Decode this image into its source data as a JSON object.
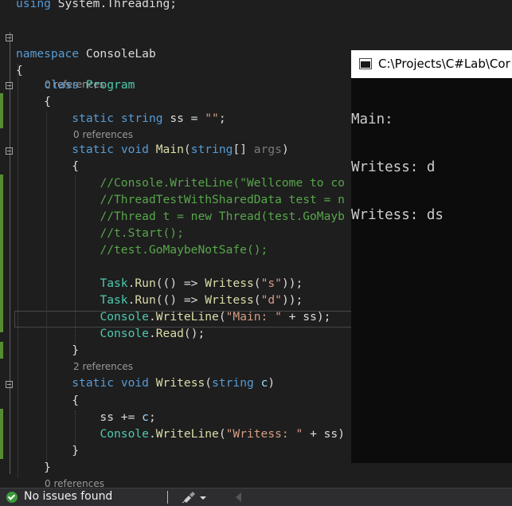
{
  "editor": {
    "lines": [
      {
        "tokens": [
          {
            "t": "using",
            "c": "kw"
          },
          {
            "t": " System.Threading;",
            "c": "ns"
          }
        ]
      },
      {
        "tokens": []
      },
      {
        "tokens": [
          {
            "t": "namespace",
            "c": "kw"
          },
          {
            "t": " ConsoleLab",
            "c": "ns"
          }
        ]
      },
      {
        "tokens": [
          {
            "t": "{",
            "c": "ns"
          }
        ]
      },
      {
        "lens": "0 references"
      },
      {
        "tokens": [
          {
            "t": "    "
          },
          {
            "t": "class",
            "c": "kw"
          },
          {
            "t": " "
          },
          {
            "t": "Program",
            "c": "ty"
          }
        ]
      },
      {
        "tokens": [
          {
            "t": "    {",
            "c": "ns"
          }
        ]
      },
      {
        "tokens": [
          {
            "t": "        "
          },
          {
            "t": "static",
            "c": "kw"
          },
          {
            "t": " "
          },
          {
            "t": "string",
            "c": "kw"
          },
          {
            "t": " ss = ",
            "c": "ns"
          },
          {
            "t": "\"\"",
            "c": "st"
          },
          {
            "t": ";",
            "c": "ns"
          }
        ]
      },
      {
        "lens": "0 references"
      },
      {
        "tokens": [
          {
            "t": "        "
          },
          {
            "t": "static",
            "c": "kw"
          },
          {
            "t": " "
          },
          {
            "t": "void",
            "c": "kw"
          },
          {
            "t": " "
          },
          {
            "t": "Main",
            "c": "fn"
          },
          {
            "t": "(",
            "c": "ns"
          },
          {
            "t": "string",
            "c": "kw"
          },
          {
            "t": "[] ",
            "c": "ns"
          },
          {
            "t": "args",
            "c": "dim"
          },
          {
            "t": ")",
            "c": "ns"
          }
        ]
      },
      {
        "tokens": [
          {
            "t": "        {",
            "c": "ns"
          }
        ]
      },
      {
        "tokens": [
          {
            "t": "            "
          },
          {
            "t": "//Console.WriteLine(\"Wellcome to co",
            "c": "cm"
          }
        ]
      },
      {
        "tokens": [
          {
            "t": "            "
          },
          {
            "t": "//ThreadTestWithSharedData test = n",
            "c": "cm"
          }
        ]
      },
      {
        "tokens": [
          {
            "t": "            "
          },
          {
            "t": "//Thread t = new Thread(test.GoMayb",
            "c": "cm"
          }
        ]
      },
      {
        "tokens": [
          {
            "t": "            "
          },
          {
            "t": "//t.Start();",
            "c": "cm"
          }
        ]
      },
      {
        "tokens": [
          {
            "t": "            "
          },
          {
            "t": "//test.GoMaybeNotSafe();",
            "c": "cm"
          }
        ]
      },
      {
        "tokens": []
      },
      {
        "tokens": [
          {
            "t": "            "
          },
          {
            "t": "Task",
            "c": "ty"
          },
          {
            "t": ".",
            "c": "ns"
          },
          {
            "t": "Run",
            "c": "fn"
          },
          {
            "t": "(() => ",
            "c": "ns"
          },
          {
            "t": "Writess",
            "c": "fn"
          },
          {
            "t": "(",
            "c": "ns"
          },
          {
            "t": "\"s\"",
            "c": "st"
          },
          {
            "t": "));",
            "c": "ns"
          }
        ]
      },
      {
        "tokens": [
          {
            "t": "            "
          },
          {
            "t": "Task",
            "c": "ty"
          },
          {
            "t": ".",
            "c": "ns"
          },
          {
            "t": "Run",
            "c": "fn"
          },
          {
            "t": "(() => ",
            "c": "ns"
          },
          {
            "t": "Writess",
            "c": "fn"
          },
          {
            "t": "(",
            "c": "ns"
          },
          {
            "t": "\"d\"",
            "c": "st"
          },
          {
            "t": "));",
            "c": "ns"
          }
        ]
      },
      {
        "tokens": [
          {
            "t": "            "
          },
          {
            "t": "Console",
            "c": "ty"
          },
          {
            "t": ".",
            "c": "ns"
          },
          {
            "t": "WriteLine",
            "c": "fn"
          },
          {
            "t": "(",
            "c": "ns"
          },
          {
            "t": "\"Main: \"",
            "c": "st"
          },
          {
            "t": " + ss);",
            "c": "ns"
          }
        ]
      },
      {
        "tokens": [
          {
            "t": "            "
          },
          {
            "t": "Console",
            "c": "ty"
          },
          {
            "t": ".",
            "c": "ns"
          },
          {
            "t": "Read",
            "c": "fn"
          },
          {
            "t": "();",
            "c": "ns"
          }
        ]
      },
      {
        "tokens": [
          {
            "t": "        }",
            "c": "ns"
          }
        ]
      },
      {
        "lens": "2 references"
      },
      {
        "tokens": [
          {
            "t": "        "
          },
          {
            "t": "static",
            "c": "kw"
          },
          {
            "t": " "
          },
          {
            "t": "void",
            "c": "kw"
          },
          {
            "t": " "
          },
          {
            "t": "Writess",
            "c": "fn"
          },
          {
            "t": "(",
            "c": "ns"
          },
          {
            "t": "string",
            "c": "kw"
          },
          {
            "t": " ",
            "c": "ns"
          },
          {
            "t": "c",
            "c": "pr"
          },
          {
            "t": ")",
            "c": "ns"
          }
        ]
      },
      {
        "tokens": [
          {
            "t": "        {",
            "c": "ns"
          }
        ]
      },
      {
        "tokens": [
          {
            "t": "            ss += ",
            "c": "ns"
          },
          {
            "t": "c",
            "c": "pr"
          },
          {
            "t": ";",
            "c": "ns"
          }
        ]
      },
      {
        "tokens": [
          {
            "t": "            "
          },
          {
            "t": "Console",
            "c": "ty"
          },
          {
            "t": ".",
            "c": "ns"
          },
          {
            "t": "WriteLine",
            "c": "fn"
          },
          {
            "t": "(",
            "c": "ns"
          },
          {
            "t": "\"Writess: \"",
            "c": "st"
          },
          {
            "t": " + ss)",
            "c": "ns"
          }
        ]
      },
      {
        "tokens": [
          {
            "t": "        }",
            "c": "ns"
          }
        ]
      },
      {
        "tokens": [
          {
            "t": "    }",
            "c": "ns"
          }
        ]
      },
      {
        "lens": "0 references"
      }
    ]
  },
  "console": {
    "title": "C:\\Projects\\C#Lab\\Cor",
    "output": [
      "Main:",
      "Writess: d",
      "Writess: ds"
    ]
  },
  "status": {
    "text": "No issues found"
  },
  "colors": {
    "keyword": "#569cd6",
    "type": "#4ec9b0",
    "string": "#d69d85",
    "comment": "#57a64a",
    "method": "#dcdcaa",
    "change_bar": "#578d32"
  }
}
